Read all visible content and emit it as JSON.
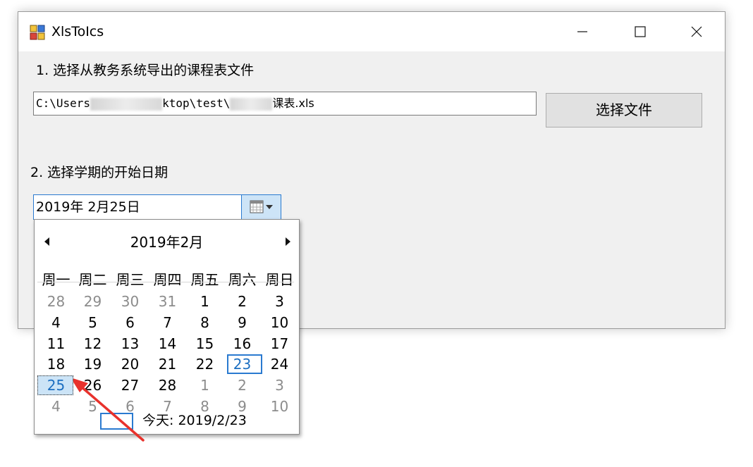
{
  "window": {
    "title": "XlsToIcs",
    "icon": "app-grid-icon"
  },
  "controls": {
    "minimize_icon": "minimize-icon",
    "maximize_icon": "maximize-icon",
    "close_icon": "close-icon"
  },
  "step1": {
    "label": "1. 选择从教务系统导出的课程表文件",
    "file_prefix": "C:\\Users",
    "file_middle": "ktop\\test\\",
    "file_suffix": "课表.xls",
    "choose_button": "选择文件"
  },
  "step2": {
    "label": "2. 选择学期的开始日期",
    "date_value": "2019年 2月25日",
    "calendar_icon": "calendar-dropdown-icon"
  },
  "calendar": {
    "month_title": "2019年2月",
    "prev_icon": "prev-month-icon",
    "next_icon": "next-month-icon",
    "weekdays": [
      "周一",
      "周二",
      "周三",
      "周四",
      "周五",
      "周六",
      "周日"
    ],
    "weeks": [
      [
        {
          "d": "28",
          "s": "other"
        },
        {
          "d": "29",
          "s": "other"
        },
        {
          "d": "30",
          "s": "other"
        },
        {
          "d": "31",
          "s": "other"
        },
        {
          "d": "1",
          "s": "cur"
        },
        {
          "d": "2",
          "s": "cur"
        },
        {
          "d": "3",
          "s": "cur"
        }
      ],
      [
        {
          "d": "4",
          "s": "cur"
        },
        {
          "d": "5",
          "s": "cur"
        },
        {
          "d": "6",
          "s": "cur"
        },
        {
          "d": "7",
          "s": "cur"
        },
        {
          "d": "8",
          "s": "cur"
        },
        {
          "d": "9",
          "s": "cur"
        },
        {
          "d": "10",
          "s": "cur"
        }
      ],
      [
        {
          "d": "11",
          "s": "cur"
        },
        {
          "d": "12",
          "s": "cur"
        },
        {
          "d": "13",
          "s": "cur"
        },
        {
          "d": "14",
          "s": "cur"
        },
        {
          "d": "15",
          "s": "cur"
        },
        {
          "d": "16",
          "s": "cur"
        },
        {
          "d": "17",
          "s": "cur"
        }
      ],
      [
        {
          "d": "18",
          "s": "cur"
        },
        {
          "d": "19",
          "s": "cur"
        },
        {
          "d": "20",
          "s": "cur"
        },
        {
          "d": "21",
          "s": "cur"
        },
        {
          "d": "22",
          "s": "cur"
        },
        {
          "d": "23",
          "s": "today"
        },
        {
          "d": "24",
          "s": "cur"
        }
      ],
      [
        {
          "d": "25",
          "s": "selected"
        },
        {
          "d": "26",
          "s": "cur"
        },
        {
          "d": "27",
          "s": "cur"
        },
        {
          "d": "28",
          "s": "cur"
        },
        {
          "d": "1",
          "s": "other"
        },
        {
          "d": "2",
          "s": "other"
        },
        {
          "d": "3",
          "s": "other"
        }
      ],
      [
        {
          "d": "4",
          "s": "other"
        },
        {
          "d": "5",
          "s": "other"
        },
        {
          "d": "6",
          "s": "other"
        },
        {
          "d": "7",
          "s": "other"
        },
        {
          "d": "8",
          "s": "other"
        },
        {
          "d": "9",
          "s": "other"
        },
        {
          "d": "10",
          "s": "other"
        }
      ]
    ],
    "today_label": "今天: 2019/2/23"
  },
  "colors": {
    "accent": "#2a7ad0",
    "selected_bg": "#cce4f7",
    "annotation_arrow": "#e8322c"
  }
}
